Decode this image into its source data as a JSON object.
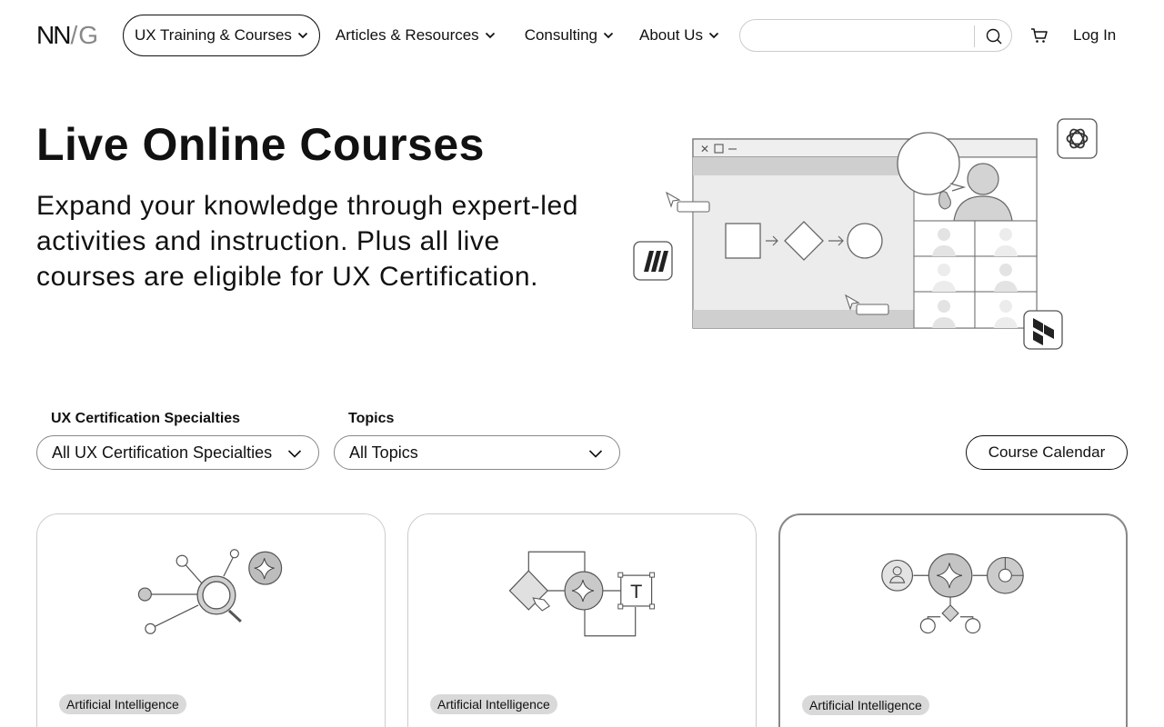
{
  "brand": {
    "logo_nn": "NN",
    "logo_slash": "/",
    "logo_g": "G"
  },
  "nav": {
    "items": [
      {
        "label": "UX Training & Courses"
      },
      {
        "label": "Articles & Resources"
      },
      {
        "label": "Consulting"
      },
      {
        "label": "About Us"
      }
    ]
  },
  "search": {
    "placeholder": "",
    "value": ""
  },
  "header": {
    "login_label": "Log In"
  },
  "hero": {
    "title": "Live Online Courses",
    "subtitle": "Expand your knowledge through expert-led activities and instruction. Plus all live courses are eligible for UX Certification."
  },
  "filters": {
    "specialties": {
      "label": "UX Certification Specialties",
      "selected": "All UX Certification Specialties"
    },
    "topics": {
      "label": "Topics",
      "selected": "All Topics"
    },
    "calendar_label": "Course Calendar"
  },
  "cards": [
    {
      "tag": "Artificial Intelligence"
    },
    {
      "tag": "Artificial Intelligence"
    },
    {
      "tag": "Artificial Intelligence"
    }
  ],
  "colors": {
    "text": "#111111",
    "muted": "#888888",
    "tag_bg": "#d9d9d9",
    "border": "#cccccc"
  },
  "icons": [
    "search-icon",
    "cart-icon",
    "chevron-down-icon",
    "openai-icon",
    "miro-icon",
    "dovetail-icon",
    "sparkle-icon"
  ]
}
